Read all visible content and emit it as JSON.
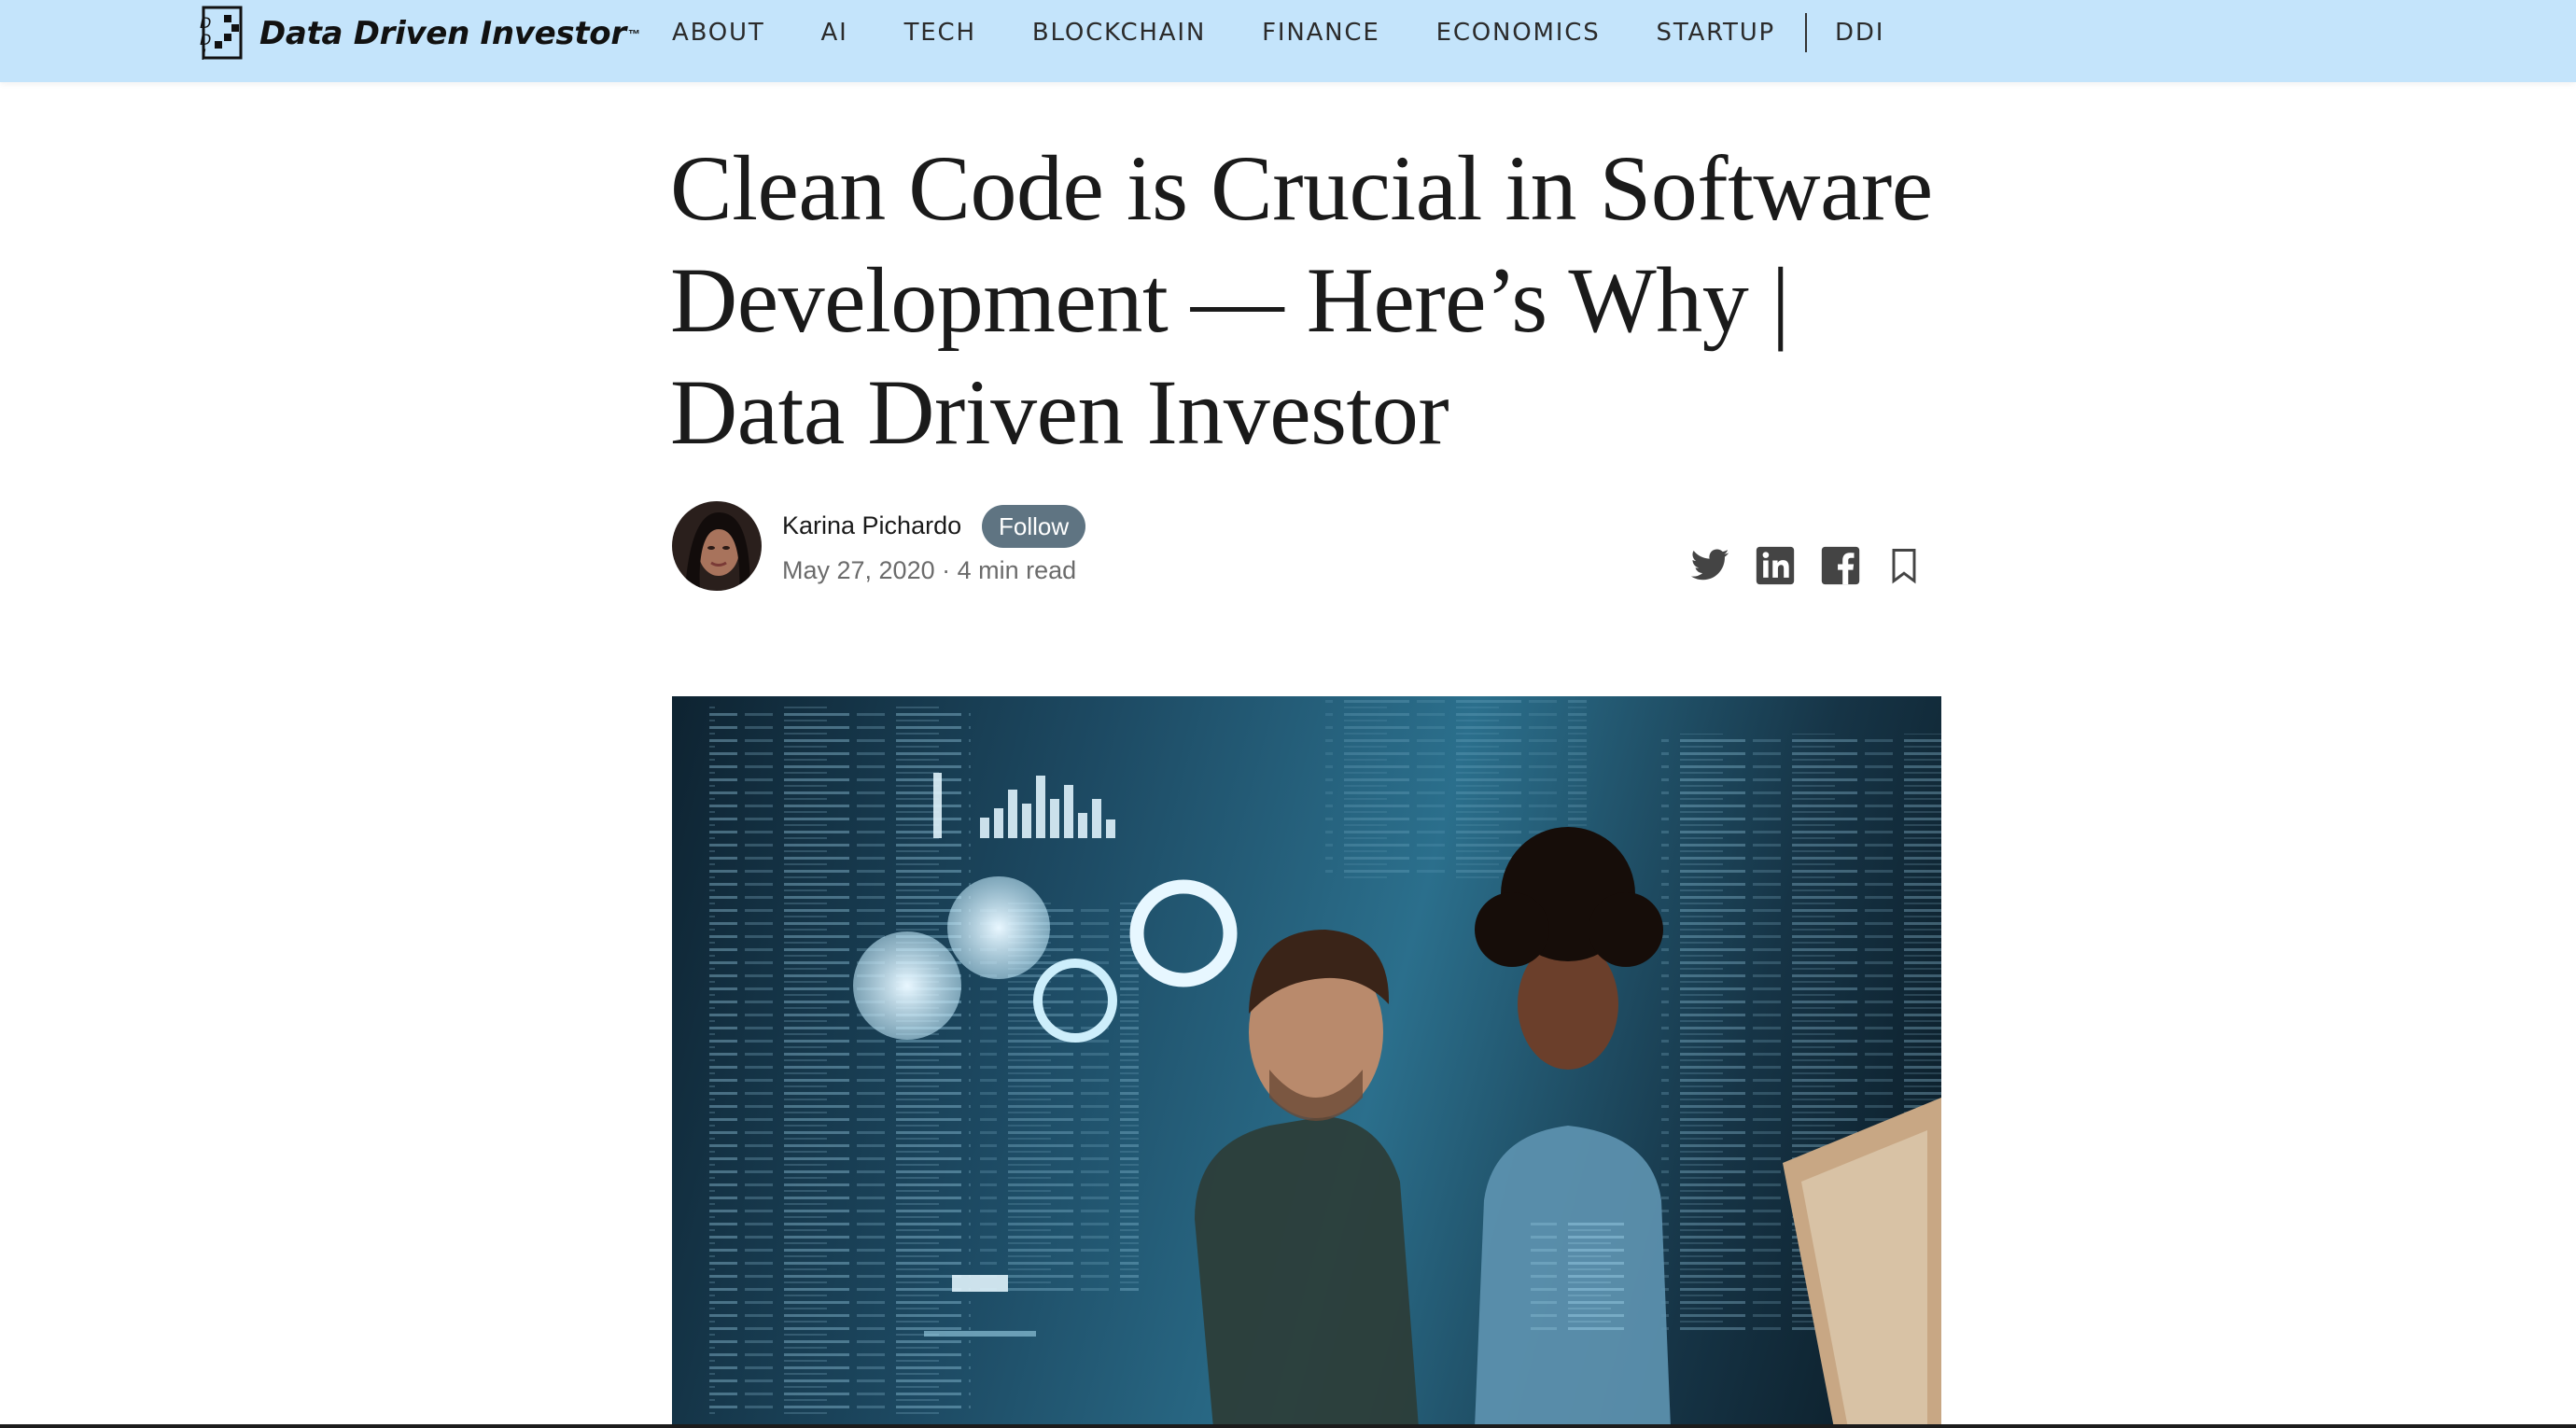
{
  "brand": {
    "name": "Data Driven Investor",
    "trademark": "™"
  },
  "nav": {
    "items": [
      "ABOUT",
      "AI",
      "TECH",
      "BLOCKCHAIN",
      "FINANCE",
      "ECONOMICS",
      "STARTUP",
      "DDI"
    ]
  },
  "article": {
    "title": "Clean Code is Crucial in Software Development — Here’s Why | Data Driven Investor",
    "author": "Karina Pichardo",
    "follow_label": "Follow",
    "meta": "May 27, 2020 · 4 min read"
  },
  "share": {
    "icons": [
      "twitter-icon",
      "linkedin-icon",
      "facebook-icon",
      "bookmark-icon"
    ]
  },
  "colors": {
    "topbar": "#c4e4fb",
    "follow_button": "#5f7482",
    "title": "#1a1a1a",
    "meta": "#6b6b6b"
  }
}
